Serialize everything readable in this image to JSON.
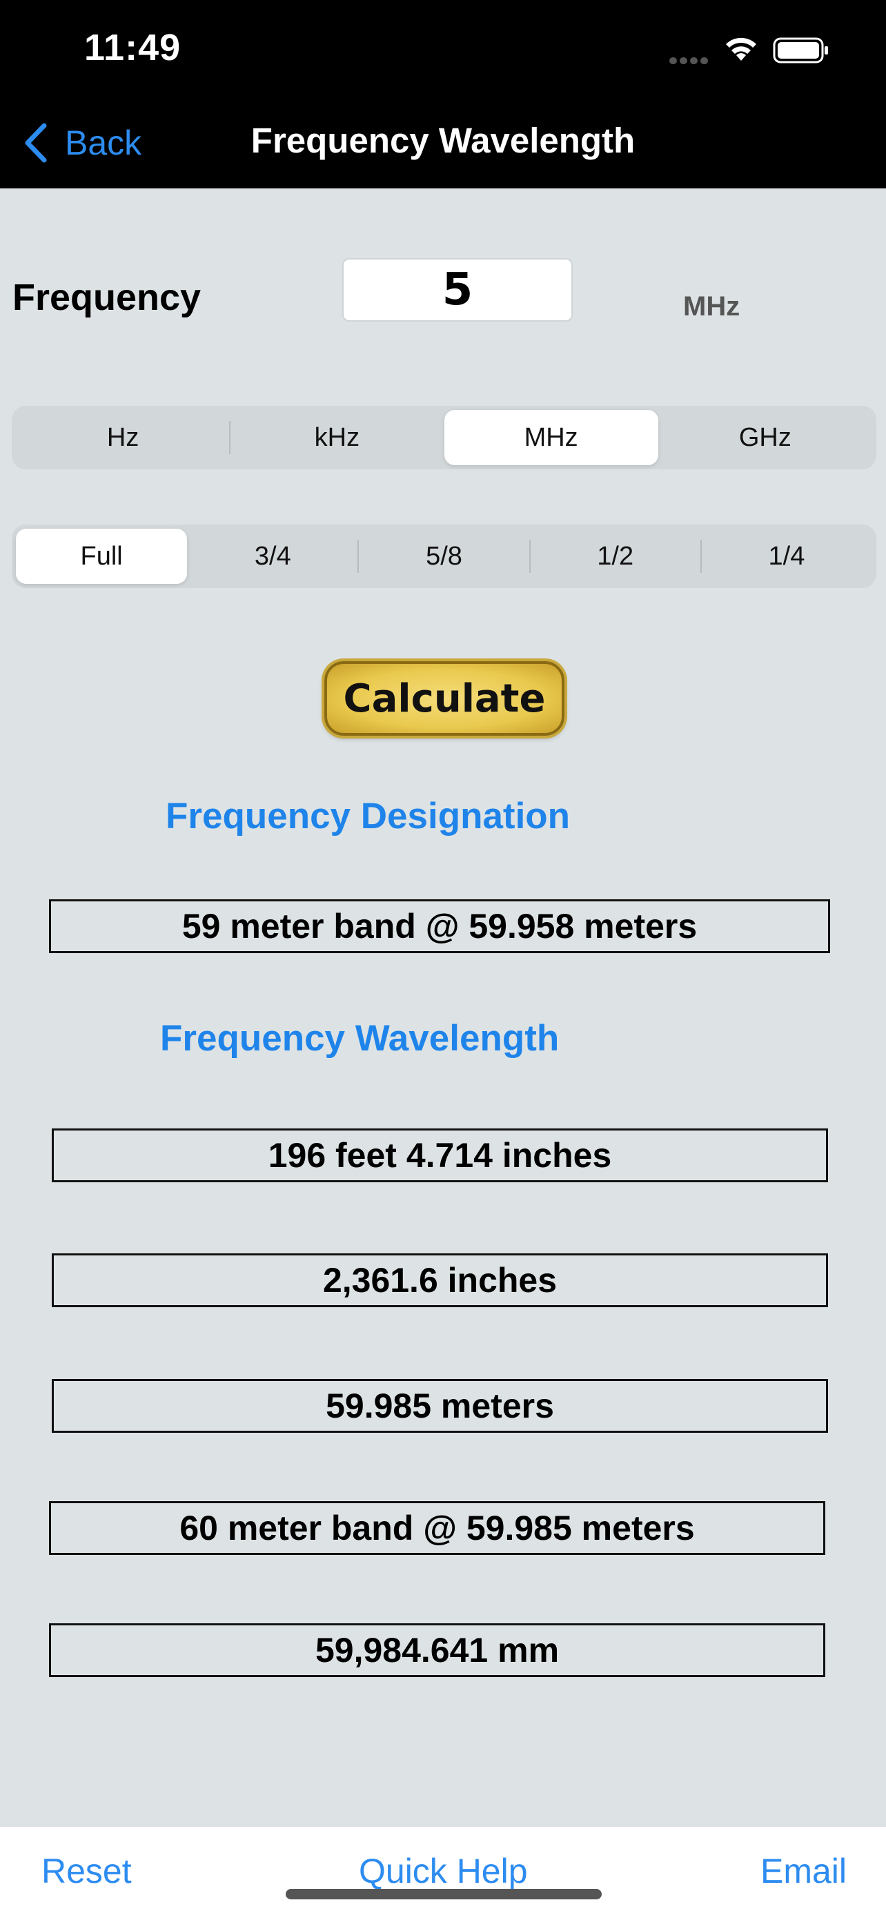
{
  "status_bar": {
    "time": "11:49",
    "icons": [
      "cellular-dots-icon",
      "wifi-icon",
      "battery-icon"
    ]
  },
  "nav": {
    "back_label": "Back",
    "title": "Frequency Wavelength"
  },
  "frequency": {
    "label": "Frequency",
    "value": "5",
    "unit": "MHz"
  },
  "unit_segments": [
    {
      "label": "Hz",
      "selected": false
    },
    {
      "label": "kHz",
      "selected": false
    },
    {
      "label": "MHz",
      "selected": true
    },
    {
      "label": "GHz",
      "selected": false
    }
  ],
  "fraction_segments": [
    {
      "label": "Full",
      "selected": true
    },
    {
      "label": "3/4",
      "selected": false
    },
    {
      "label": "5/8",
      "selected": false
    },
    {
      "label": "1/2",
      "selected": false
    },
    {
      "label": "1/4",
      "selected": false
    }
  ],
  "calculate_label": "Calculate",
  "designation": {
    "heading": "Frequency Designation",
    "result": "59 meter band @ 59.958 meters"
  },
  "wavelength": {
    "heading": "Frequency Wavelength",
    "feet_inches": "196 feet 4.714 inches",
    "inches": "2,361.6 inches",
    "meters": "59.985 meters",
    "band": "60 meter band @ 59.985 meters",
    "millimeters": "59,984.641 mm"
  },
  "toolbar": {
    "reset": "Reset",
    "quick_help": "Quick Help",
    "email": "Email"
  },
  "colors": {
    "accent": "#2d8cf0",
    "heading_blue": "#1f84ea",
    "background": "#dde3e5",
    "button_gold": "#e9c94e"
  }
}
